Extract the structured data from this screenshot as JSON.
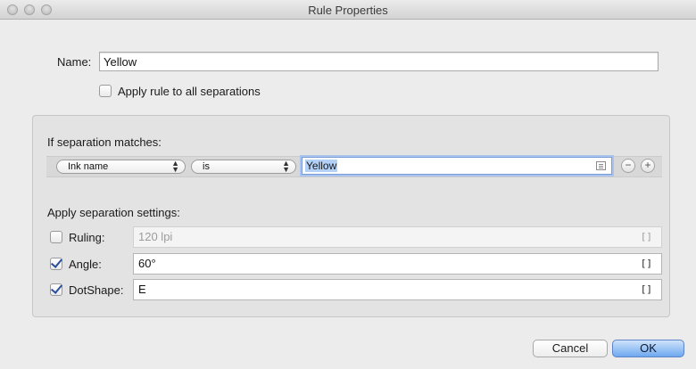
{
  "window": {
    "title": "Rule Properties"
  },
  "name": {
    "label": "Name:",
    "value": "Yellow"
  },
  "apply_all": {
    "label": "Apply rule to all separations",
    "checked": false
  },
  "match": {
    "heading": "If separation matches:",
    "field": "Ink name",
    "operator": "is",
    "value": "Yellow",
    "remove_symbol": "−",
    "add_symbol": "+"
  },
  "settings": {
    "heading": "Apply separation settings:",
    "rows": [
      {
        "label": "Ruling:",
        "checked": false,
        "value": "120 lpi",
        "disabled": true,
        "suffix": "[]"
      },
      {
        "label": "Angle:",
        "checked": true,
        "value": "60°",
        "disabled": false,
        "suffix": "[]"
      },
      {
        "label": "DotShape:",
        "checked": true,
        "value": "E",
        "disabled": false,
        "suffix": "[]"
      }
    ]
  },
  "buttons": {
    "cancel": "Cancel",
    "ok": "OK"
  }
}
